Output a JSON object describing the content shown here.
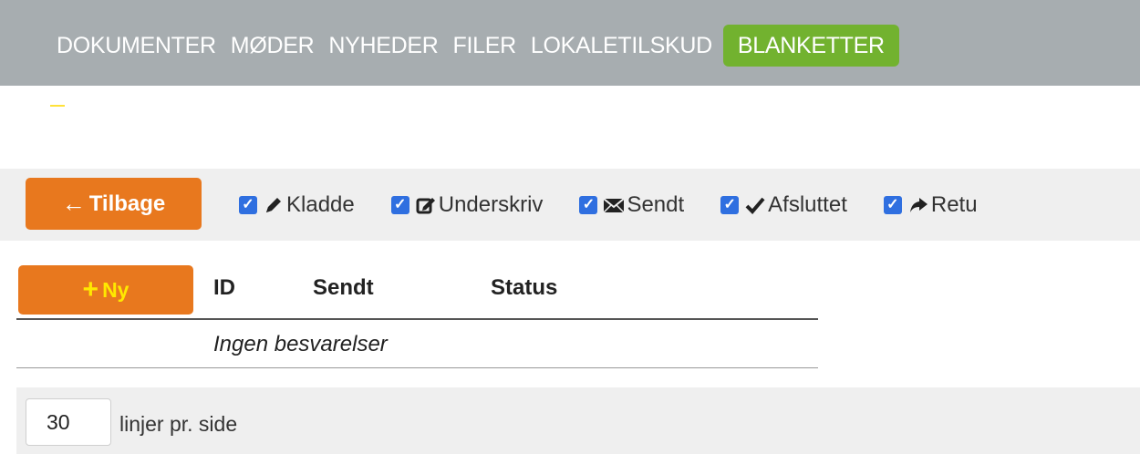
{
  "nav": {
    "items": [
      {
        "label": "DOKUMENTER"
      },
      {
        "label": "MØDER"
      },
      {
        "label": "NYHEDER"
      },
      {
        "label": "FILER"
      },
      {
        "label": "LOKALETILSKUD"
      },
      {
        "label": "BLANKETTER",
        "active": true
      }
    ],
    "active_color": "#72b22f",
    "bar_color": "#a7adb0"
  },
  "toolbar": {
    "back_label": "Tilbage",
    "back_icon": "arrow-left-icon",
    "filters": [
      {
        "label": "Kladde",
        "icon": "pencil-icon",
        "checked": true
      },
      {
        "label": "Underskriv",
        "icon": "edit-square-icon",
        "checked": true
      },
      {
        "label": "Sendt",
        "icon": "envelope-icon",
        "checked": true
      },
      {
        "label": "Afsluttet",
        "icon": "checkmark-icon",
        "checked": true
      },
      {
        "label": "Retu",
        "icon": "share-arrow-icon",
        "checked": true
      }
    ]
  },
  "table": {
    "new_label": "Ny",
    "new_icon": "plus-icon",
    "columns": [
      "ID",
      "Sendt",
      "Status"
    ],
    "empty_text": "Ingen besvarelser"
  },
  "pager": {
    "page_size": "30",
    "label": "linjer pr. side"
  },
  "colors": {
    "accent_orange": "#e8781e",
    "checkbox_blue": "#2f6fe0",
    "band_gray": "#efefef"
  }
}
